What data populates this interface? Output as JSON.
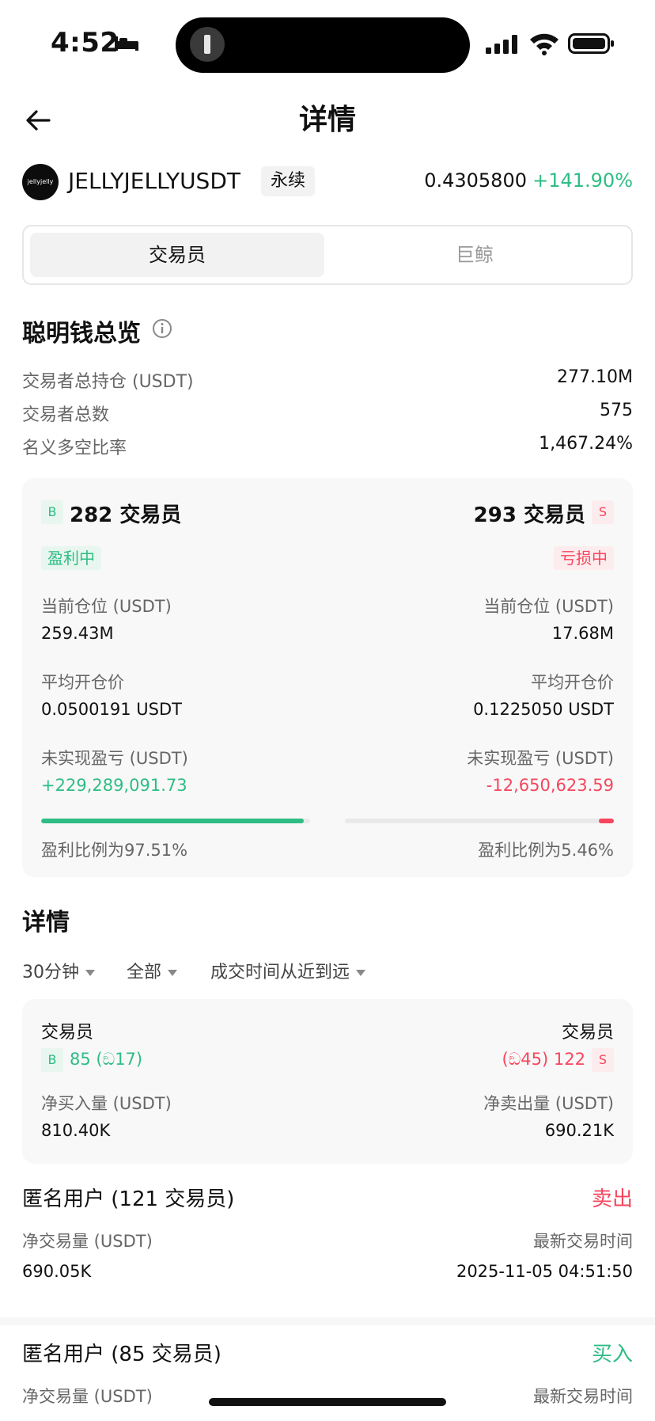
{
  "status_bar": {
    "time": "4:52"
  },
  "header": {
    "title": "详情"
  },
  "symbol": {
    "logo_text": "jellyjelly",
    "name": "JELLYJELLYUSDT",
    "badge": "永续",
    "price": "0.4305800",
    "change": "+141.90%"
  },
  "tabs": [
    {
      "label": "交易员",
      "active": true
    },
    {
      "label": "巨鲸",
      "active": false
    }
  ],
  "overview": {
    "title": "聪明钱总览",
    "rows": [
      {
        "label": "交易者总持仓 (USDT)",
        "value": "277.10M"
      },
      {
        "label": "交易者总数",
        "value": "575"
      },
      {
        "label": "名义多空比率",
        "value": "1,467.24%"
      }
    ]
  },
  "long_short": {
    "long": {
      "badge": "B",
      "count": "282 交易员",
      "status": "盈利中",
      "position_label": "当前仓位 (USDT)",
      "position_value": "259.43M",
      "avg_price_label": "平均开仓价",
      "avg_price_value": "0.0500191 USDT",
      "pnl_label": "未实现盈亏 (USDT)",
      "pnl_value": "+229,289,091.73",
      "ratio_text": "盈利比例为97.51%",
      "ratio": 0.9751
    },
    "short": {
      "badge": "S",
      "count": "293 交易员",
      "status": "亏损中",
      "position_label": "当前仓位 (USDT)",
      "position_value": "17.68M",
      "avg_price_label": "平均开仓价",
      "avg_price_value": "0.1225050 USDT",
      "pnl_label": "未实现盈亏 (USDT)",
      "pnl_value": "-12,650,623.59",
      "ratio_text": "盈利比例为5.46%",
      "ratio": 0.0546
    }
  },
  "details": {
    "title": "详情",
    "filters": [
      "30分钟",
      "全部",
      "成交时间从近到远"
    ],
    "summary": {
      "left_label": "交易员",
      "left_badge": "B",
      "left_count": "85",
      "left_sub": "17",
      "right_label": "交易员",
      "right_badge": "S",
      "right_count": "122",
      "right_sub": "45",
      "net_buy_label": "净买入量 (USDT)",
      "net_buy_value": "810.40K",
      "net_sell_label": "净卖出量 (USDT)",
      "net_sell_value": "690.21K"
    },
    "entries": [
      {
        "title": "匿名用户 (121 交易员)",
        "action": "卖出",
        "net_label": "净交易量 (USDT)",
        "net_value": "690.05K",
        "time_label": "最新交易时间",
        "time_value": "2025-11-05 04:51:50"
      },
      {
        "title": "匿名用户 (85 交易员)",
        "action": "买入",
        "net_label": "净交易量 (USDT)",
        "time_label": "最新交易时间"
      }
    ]
  },
  "colors": {
    "up": "#2ebd85",
    "down": "#f6465d"
  }
}
